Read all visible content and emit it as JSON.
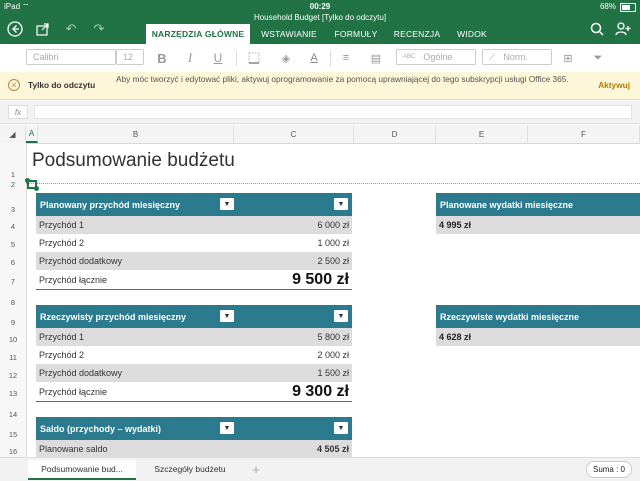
{
  "status": {
    "device": "iPad",
    "wifi": "wifi-icon",
    "time": "00:29",
    "battery": "68%"
  },
  "window": {
    "title": "Household Budget [Tylko do odczytu]"
  },
  "tabs": [
    {
      "label": "NARZĘDZIA GŁÓWNE",
      "active": true
    },
    {
      "label": "WSTAWIANIE"
    },
    {
      "label": "FORMUŁY"
    },
    {
      "label": "RECENZJA"
    },
    {
      "label": "WIDOK"
    }
  ],
  "ribbon": {
    "font": "Calibri",
    "size": "12",
    "bold": "B",
    "italic": "I",
    "underline": "U",
    "number_format": "Ogólne",
    "cell_style": "Norm."
  },
  "readonly_bar": {
    "title": "Tylko do odczytu",
    "message": "Aby móc tworzyć i edytować pliki, aktywuj oprogramowanie za pomocą uprawniającej do tego subskrypcji usługi Office 365.",
    "action": "Aktywuj"
  },
  "formula_bar": {
    "fx": "fx",
    "value": ""
  },
  "columns": [
    "A",
    "B",
    "C",
    "D",
    "E",
    "F"
  ],
  "rows": [
    "1",
    "2",
    "3",
    "4",
    "5",
    "6",
    "7",
    "8",
    "9",
    "10",
    "11",
    "12",
    "13",
    "14",
    "15",
    "16"
  ],
  "sheet": {
    "title": "Podsumowanie budżetu",
    "planned_income": {
      "header": "Planowany przychód miesięczny",
      "rows": [
        {
          "label": "Przychód 1",
          "value": "6 000 zł"
        },
        {
          "label": "Przychód 2",
          "value": "1 000 zł"
        },
        {
          "label": "Przychód dodatkowy",
          "value": "2 500 zł"
        }
      ],
      "total_label": "Przychód łącznie",
      "total_value": "9 500 zł"
    },
    "actual_income": {
      "header": "Rzeczywisty przychód miesięczny",
      "rows": [
        {
          "label": "Przychód 1",
          "value": "5 800 zł"
        },
        {
          "label": "Przychód 2",
          "value": "2 000 zł"
        },
        {
          "label": "Przychód dodatkowy",
          "value": "1 500 zł"
        }
      ],
      "total_label": "Przychód łącznie",
      "total_value": "9 300 zł"
    },
    "balance": {
      "header": "Saldo (przychody – wydatki)",
      "rows": [
        {
          "label": "Planowane saldo",
          "value": "4 505 zł"
        }
      ]
    },
    "planned_expenses": {
      "header": "Planowane wydatki miesięczne",
      "value": "4 995 zł"
    },
    "actual_expenses": {
      "header": "Rzeczywiste wydatki miesięczne",
      "value": "4 628 zł"
    }
  },
  "sheet_tabs": [
    {
      "label": "Podsumowanie bud...",
      "active": true
    },
    {
      "label": "Szczegóły budżetu"
    }
  ],
  "add_sheet": "+",
  "status_sum": "Suma : 0",
  "colors": {
    "accent": "#217346",
    "table_header": "#2b7a8e",
    "readonly_bg": "#fdf6d8"
  }
}
